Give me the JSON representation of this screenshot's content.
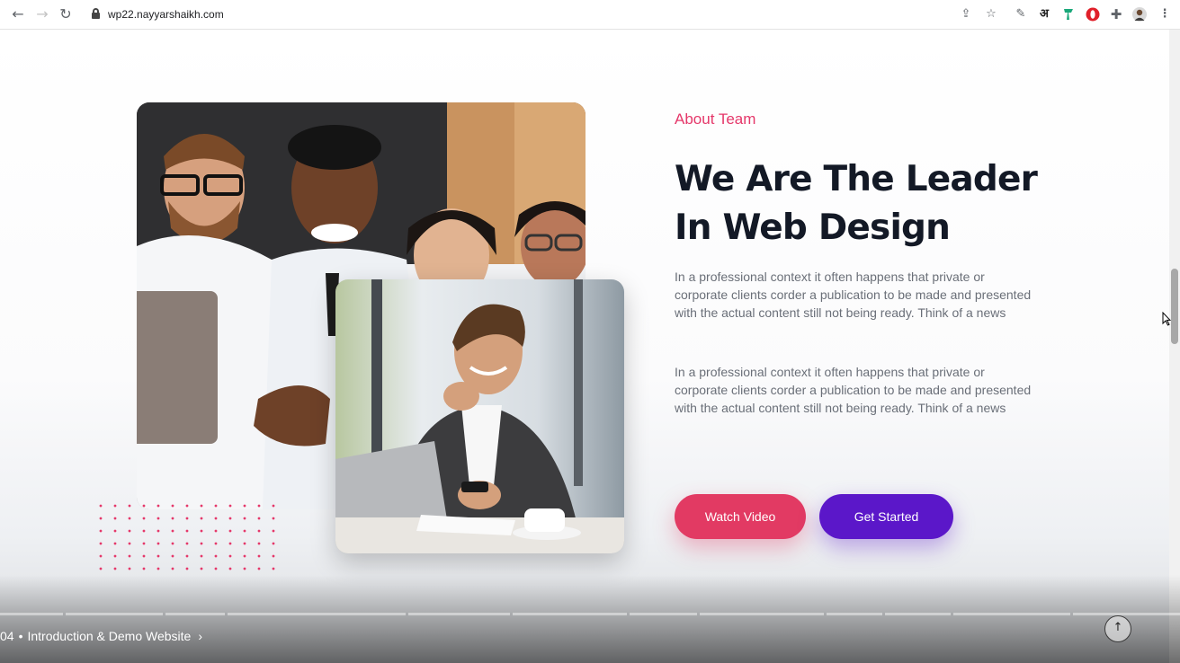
{
  "browser": {
    "url": "wp22.nayyarshaikh.com",
    "icons": [
      "back-icon",
      "forward-icon",
      "reload-icon",
      "lock-icon",
      "share-icon",
      "bookmark-star-icon",
      "eyedropper-icon",
      "hindi-input-icon",
      "extension-icon",
      "opera-icon",
      "puzzle-icon",
      "profile-avatar-icon",
      "menu-icon"
    ],
    "hindi_label": "अ"
  },
  "about": {
    "eyebrow": "About Team",
    "headline_line1": "We Are The Leader",
    "headline_line2": "In Web Design",
    "paragraph1": "In a professional context it often happens that private or corporate clients corder a publication to be made and presented with the actual content still not being ready. Think of a news",
    "paragraph2": "In a professional context it often happens that private or corporate clients corder a publication to be made and presented with the actual content still not being ready. Think of a news",
    "watch_button": "Watch Video",
    "start_button": "Get Started"
  },
  "colors": {
    "accent_pink": "#e5386a",
    "button_pink": "#e23a63",
    "button_purple": "#5b17c9",
    "headline": "#131926"
  },
  "video": {
    "chapter_number": "04",
    "chapter_separator": "•",
    "chapter_title": "Introduction & Demo Website",
    "chevron": "›",
    "scroll_top_glyph": "↑"
  }
}
